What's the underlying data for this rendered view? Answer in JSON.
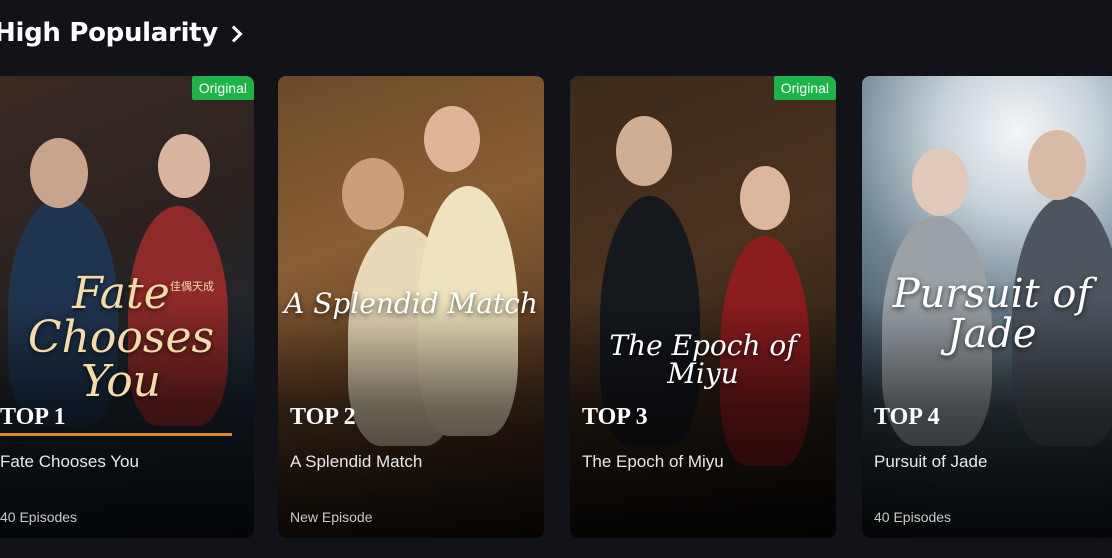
{
  "section": {
    "title": "High Popularity"
  },
  "cards": [
    {
      "rank": "TOP 1",
      "badge": "Original",
      "poster_title": "Fate Chooses You",
      "poster_subtitle": "佳偶天成",
      "title": "Fate Chooses You",
      "meta": "40 Episodes"
    },
    {
      "rank": "TOP 2",
      "badge": "",
      "poster_title": "A Splendid Match",
      "title": "A Splendid Match",
      "meta": "New Episode"
    },
    {
      "rank": "TOP 3",
      "badge": "Original",
      "poster_title": "The Epoch of Miyu",
      "title": "The Epoch of Miyu",
      "meta": ""
    },
    {
      "rank": "TOP 4",
      "badge": "",
      "poster_title": "Pursuit of Jade",
      "title": "Pursuit of Jade",
      "meta": "40 Episodes"
    }
  ],
  "colors": {
    "background": "#111318",
    "badge_green": "#1db347",
    "active_underline": "#e0892a"
  },
  "icons": {
    "section_more": "chevron-right-icon"
  }
}
